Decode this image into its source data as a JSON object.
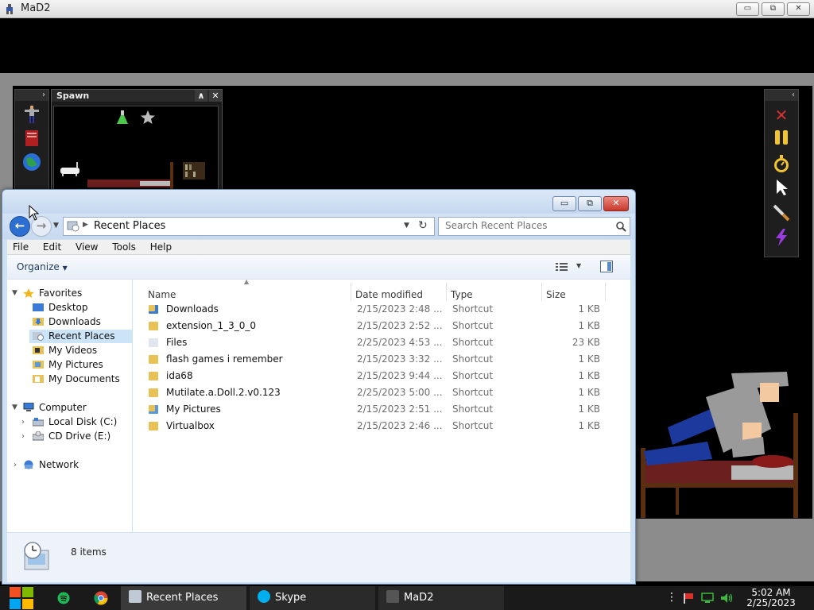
{
  "app": {
    "title": "MaD2",
    "minimize": "▭",
    "maximize": "⧉",
    "close": "✕"
  },
  "spawn_panel": {
    "title": "Spawn",
    "collapse": "∧",
    "close": "✕"
  },
  "left_toolbar": {
    "toggle": "›"
  },
  "right_toolbar": {
    "toggle": "‹"
  },
  "explorer": {
    "address": "Recent Places",
    "search_placeholder": "Search Recent Places",
    "menu": [
      "File",
      "Edit",
      "View",
      "Tools",
      "Help"
    ],
    "organize": "Organize",
    "nav": {
      "favorites": "Favorites",
      "desktop": "Desktop",
      "downloads": "Downloads",
      "recent_places": "Recent Places",
      "my_videos": "My Videos",
      "my_pictures": "My Pictures",
      "my_documents": "My Documents",
      "computer": "Computer",
      "local_disk": "Local Disk (C:)",
      "cd_drive": "CD Drive (E:)",
      "network": "Network"
    },
    "columns": {
      "name": "Name",
      "date": "Date modified",
      "type": "Type",
      "size": "Size"
    },
    "files": [
      {
        "name": "Downloads",
        "date": "2/15/2023 2:48 ...",
        "type": "Shortcut",
        "size": "1 KB",
        "icon": "download-folder"
      },
      {
        "name": "extension_1_3_0_0",
        "date": "2/15/2023 2:52 ...",
        "type": "Shortcut",
        "size": "1 KB",
        "icon": "folder"
      },
      {
        "name": "Files",
        "date": "2/25/2023 4:53 ...",
        "type": "Shortcut",
        "size": "23 KB",
        "icon": "file"
      },
      {
        "name": "flash games i remember",
        "date": "2/15/2023 3:32 ...",
        "type": "Shortcut",
        "size": "1 KB",
        "icon": "folder"
      },
      {
        "name": "ida68",
        "date": "2/15/2023 9:44 ...",
        "type": "Shortcut",
        "size": "1 KB",
        "icon": "folder"
      },
      {
        "name": "Mutilate.a.Doll.2.v0.123",
        "date": "2/25/2023 5:00 ...",
        "type": "Shortcut",
        "size": "1 KB",
        "icon": "folder"
      },
      {
        "name": "My Pictures",
        "date": "2/15/2023 2:51 ...",
        "type": "Shortcut",
        "size": "1 KB",
        "icon": "pictures-folder"
      },
      {
        "name": "Virtualbox",
        "date": "2/15/2023 2:46 ...",
        "type": "Shortcut",
        "size": "1 KB",
        "icon": "folder"
      }
    ],
    "item_count": "8 items"
  },
  "taskbar": {
    "tasks": [
      "Recent Places",
      "Skype",
      "MaD2"
    ],
    "time": "5:02 AM",
    "date": "2/25/2023"
  },
  "colors": {
    "folder": "#e8c257",
    "accent": "#3a7bd5",
    "close_red": "#d9463a"
  }
}
